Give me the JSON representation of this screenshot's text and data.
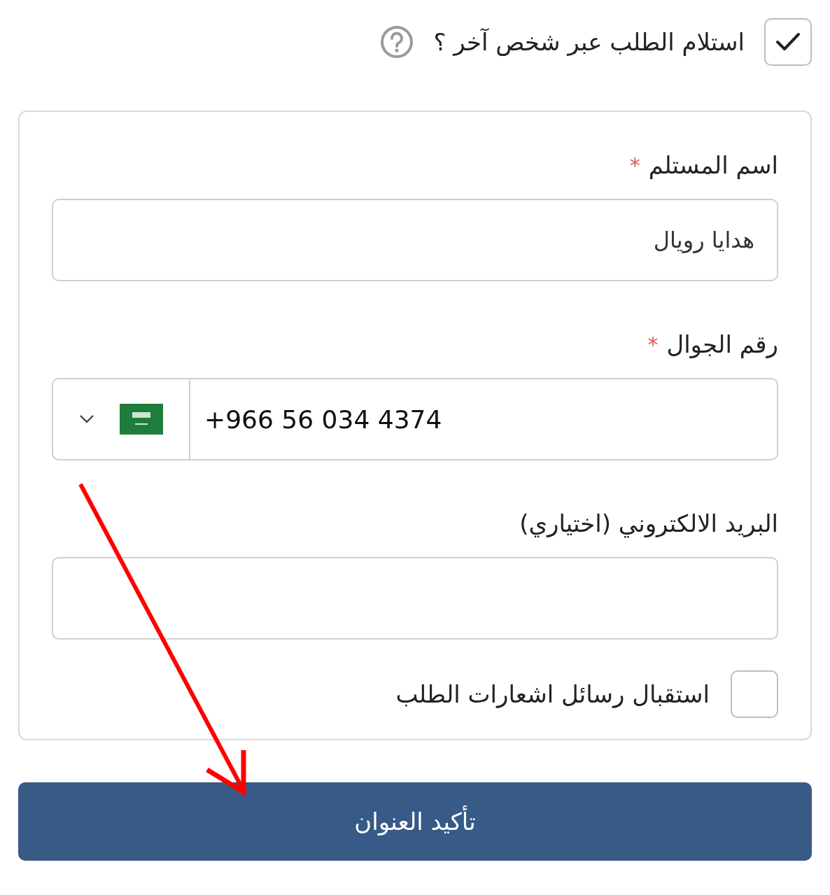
{
  "receive_via_other": {
    "label": "استلام الطلب عبر شخص آخر ؟",
    "checked": true
  },
  "fields": [
    {
      "kind": "text",
      "label": "اسم المستلم",
      "required_mark": "*",
      "value": "هدايا رويال"
    },
    {
      "kind": "phone",
      "label": "رقم الجوال",
      "required_mark": "*",
      "value": "+966 56 034 4374"
    },
    {
      "kind": "text",
      "label": "البريد الالكتروني (اختياري)"
    }
  ],
  "notifications": {
    "label": "استقبال رسائل اشعارات الطلب",
    "checked": false
  },
  "confirm_button": "تأكيد العنوان"
}
